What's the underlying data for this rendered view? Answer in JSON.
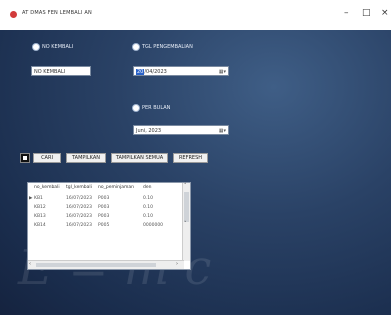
{
  "window": {
    "title": "AT DMAS FEN LEMBALI AN",
    "minimize": "–",
    "maximize": "□",
    "close": "×",
    "accent": "#d23b3b"
  },
  "form": {
    "radio_kembali": "NO KEMBALI",
    "radio_tgl": "TGL PENGEMBALIAN",
    "radio_bulan": "PER BULAN",
    "input_no_kembali": "NO KEMBALI",
    "date_tgl": "20/04/2023",
    "date_tgl_highlight": "20",
    "date_tgl_rest": "/04/2023",
    "month_value": "Juni, 2023"
  },
  "buttons": {
    "cari": "CARI",
    "tampilkan": "TAMPILKAN",
    "tampilkan_semua": "TAMPILKAN SEMUA",
    "refresh": "REFRESH"
  },
  "grid": {
    "columns": [
      "no_kembali",
      "tgl_kembali",
      "no_peminjaman",
      "den"
    ],
    "rows": [
      {
        "marker": "▶",
        "no_kembali": "KB1",
        "tgl_kembali": "16/07/2023",
        "no_peminjaman": "P003",
        "den": "0.10"
      },
      {
        "marker": "",
        "no_kembali": "KB12",
        "tgl_kembali": "16/07/2023",
        "no_peminjaman": "P003",
        "den": "0.10"
      },
      {
        "marker": "",
        "no_kembali": "KB13",
        "tgl_kembali": "16/07/2023",
        "no_peminjaman": "P003",
        "den": "0.10"
      },
      {
        "marker": "",
        "no_kembali": "KB14",
        "tgl_kembali": "16/07/2023",
        "no_peminjaman": "P005",
        "den": "0000000"
      }
    ]
  },
  "background": {
    "chalk_big": "E = m c",
    "chalk_small": "c"
  }
}
